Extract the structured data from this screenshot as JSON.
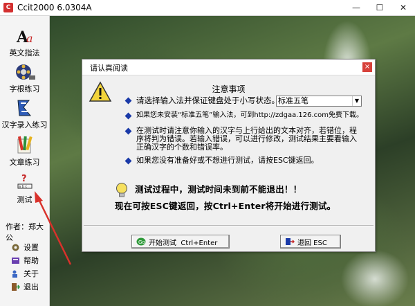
{
  "window": {
    "title": "Ccit2000 6.0304A",
    "app_icon_text": "C",
    "minimize": "—",
    "maximize": "☐",
    "close": "✕"
  },
  "sidebar": {
    "items": [
      {
        "label": "英文指法",
        "icon": "english-aa-icon"
      },
      {
        "label": "字根练习",
        "icon": "film-reel-icon"
      },
      {
        "label": "汉字录入练习",
        "icon": "chinese-input-icon"
      },
      {
        "label": "文章练习",
        "icon": "pencils-icon"
      },
      {
        "label": "测试",
        "icon": "test-question-icon"
      }
    ],
    "author": "作者：郑大公",
    "menu": [
      {
        "label": "设置",
        "icon": "gear-icon"
      },
      {
        "label": "帮助",
        "icon": "help-book-icon"
      },
      {
        "label": "关于",
        "icon": "about-icon"
      },
      {
        "label": "退出",
        "icon": "exit-icon"
      }
    ]
  },
  "dialog": {
    "title": "请认真阅读",
    "close": "×",
    "notice_title": "注意事项",
    "bullets": [
      "请选择输入法并保证键盘处于小写状态。",
      "如果您未安装“标准五笔”输入法，可到http://zdgaa.126.com免费下载。",
      "在测试时请注意你输入的汉字与上行给出的文本对齐，若错位，程序将判为错误。若输入错误，可以进行修改，测试结果主要看输入正确汉字的个数和错误率。",
      "如果您没有准备好或不想进行测试，请按ESC键返回。"
    ],
    "input_method": {
      "selected": "标准五笔"
    },
    "warning_line1": "测试过程中，测试时间未到前不能退出！！",
    "warning_line2": "现在可按ESC键返回，按Ctrl+Enter将开始进行测试。",
    "start_button": "开始测试  Ctrl+Enter",
    "back_button": "退回 ESC"
  },
  "colors": {
    "bullet": "#1a3aa8",
    "annotation_arrow": "#d9312b",
    "close_red": "#d7413a"
  }
}
